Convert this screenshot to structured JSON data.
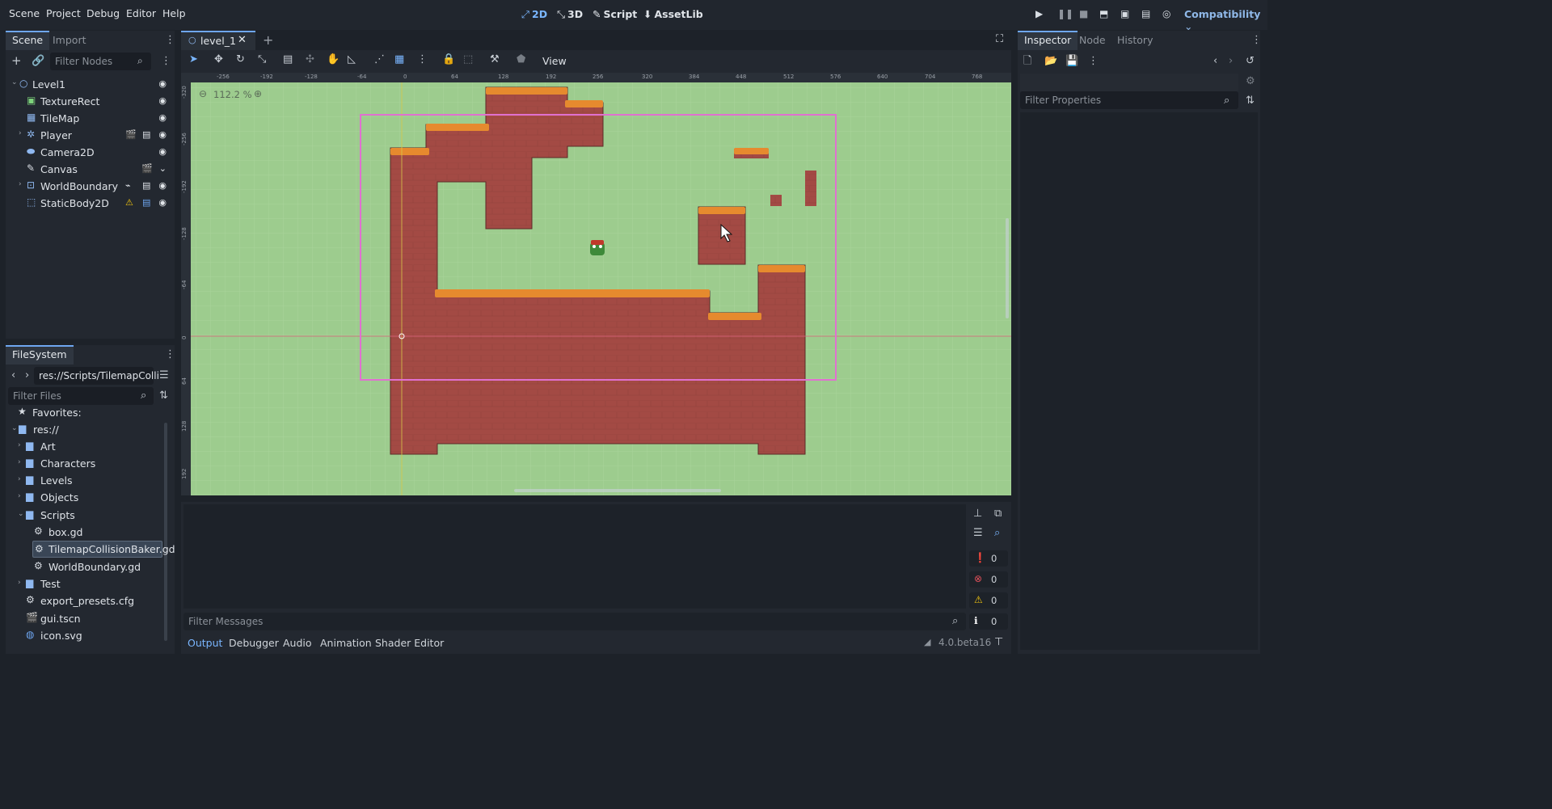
{
  "menu": [
    "Scene",
    "Project",
    "Debug",
    "Editor",
    "Help"
  ],
  "workspaces": [
    {
      "label": "2D",
      "glyph": "⤢",
      "active": true
    },
    {
      "label": "3D",
      "glyph": "⤡",
      "active": false
    },
    {
      "label": "Script",
      "glyph": "✎",
      "active": false
    },
    {
      "label": "AssetLib",
      "glyph": "⬇",
      "active": false
    }
  ],
  "renderer": "Compatibility",
  "scene_dock": {
    "tabs": [
      "Scene",
      "Import"
    ],
    "filter_placeholder": "Filter Nodes",
    "nodes": [
      {
        "name": "Level1",
        "icon": "node2d-icon"
      },
      {
        "name": "TextureRect",
        "icon": "texture-rect-icon"
      },
      {
        "name": "TileMap",
        "icon": "tilemap-icon"
      },
      {
        "name": "Player",
        "icon": "character-body-icon"
      },
      {
        "name": "Camera2D",
        "icon": "camera-icon"
      },
      {
        "name": "Canvas",
        "icon": "canvas-layer-icon"
      },
      {
        "name": "WorldBoundary",
        "icon": "area2d-icon"
      },
      {
        "name": "StaticBody2D",
        "icon": "static-body-icon"
      }
    ]
  },
  "filesystem": {
    "title": "FileSystem",
    "path": "res://Scripts/TilemapColli",
    "filter_placeholder": "Filter Files",
    "favorites": "Favorites:",
    "items": [
      {
        "label": "res://",
        "type": "folder"
      },
      {
        "label": "Art",
        "type": "folder"
      },
      {
        "label": "Characters",
        "type": "folder"
      },
      {
        "label": "Levels",
        "type": "folder"
      },
      {
        "label": "Objects",
        "type": "folder"
      },
      {
        "label": "Scripts",
        "type": "folder"
      },
      {
        "label": "box.gd",
        "type": "script"
      },
      {
        "label": "TilemapCollisionBaker.gd",
        "type": "script",
        "selected": true
      },
      {
        "label": "WorldBoundary.gd",
        "type": "script"
      },
      {
        "label": "Test",
        "type": "folder"
      },
      {
        "label": "export_presets.cfg",
        "type": "config"
      },
      {
        "label": "gui.tscn",
        "type": "scene"
      },
      {
        "label": "icon.svg",
        "type": "image"
      }
    ]
  },
  "editor": {
    "tab": "level_1",
    "view_menu": "View",
    "zoom": "112.2 %",
    "ruler_x": [
      "-256",
      "-192",
      "-128",
      "-64",
      "0",
      "64",
      "128",
      "192",
      "256",
      "320",
      "384",
      "448",
      "512",
      "576",
      "640",
      "704",
      "768"
    ],
    "ruler_y": [
      "-320",
      "-256",
      "-192",
      "-128",
      "-64",
      "0",
      "64",
      "128",
      "192"
    ]
  },
  "inspector": {
    "tabs": [
      "Inspector",
      "Node",
      "History"
    ],
    "filter_placeholder": "Filter Properties"
  },
  "bottom": {
    "filter_placeholder": "Filter Messages",
    "tabs": [
      "Output",
      "Debugger",
      "Audio",
      "Animation",
      "Shader Editor"
    ],
    "version": "4.0.beta16",
    "counts": {
      "messages": "0",
      "errors": "0",
      "warnings": "0",
      "info": "0"
    }
  },
  "colors": {
    "accent": "#7ab6ff",
    "terrain": "#a34a44",
    "grass": "#e68a2e",
    "bg_canvas": "#9dcc8e",
    "camera_frame": "#e070d0"
  }
}
